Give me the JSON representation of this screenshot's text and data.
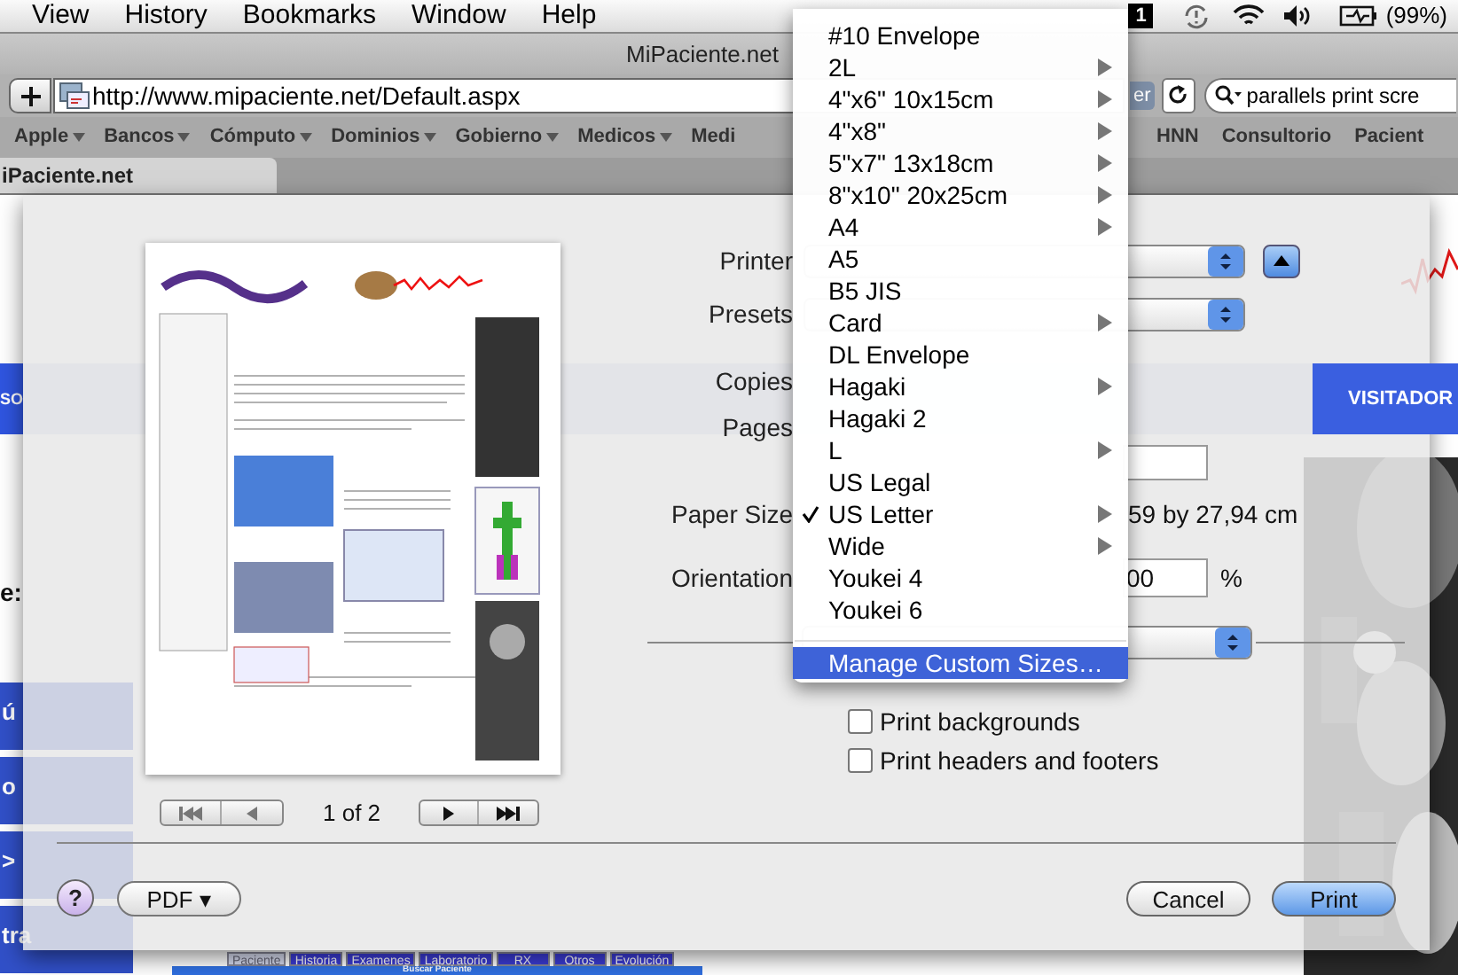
{
  "menu_bar": {
    "items": [
      "View",
      "History",
      "Bookmarks",
      "Window",
      "Help"
    ],
    "badge": "1",
    "battery": "(99%)"
  },
  "window": {
    "title": "MiPaciente.net"
  },
  "toolbar": {
    "address": "http://www.mipaciente.net/Default.aspx",
    "reader_button": "er",
    "search": "parallels print scre"
  },
  "bookmarks": [
    {
      "label": "Apple",
      "has_menu": true
    },
    {
      "label": "Bancos",
      "has_menu": true
    },
    {
      "label": "Cómputo",
      "has_menu": true
    },
    {
      "label": "Dominios",
      "has_menu": true
    },
    {
      "label": "Gobierno",
      "has_menu": true
    },
    {
      "label": "Medicos",
      "has_menu": true
    },
    {
      "label": "Medi",
      "has_menu": false
    }
  ],
  "bookmarks_right": [
    {
      "label": "HNN",
      "has_menu": false
    },
    {
      "label": "Consultorio",
      "has_menu": false
    },
    {
      "label": "Pacient",
      "has_menu": false
    }
  ],
  "tabs": [
    {
      "label": "iPaciente.net",
      "selected": true
    }
  ],
  "web_page": {
    "banner_label": "SO",
    "field_label": "e:",
    "side_menu": [
      "ú",
      "o",
      ">",
      "tra"
    ],
    "visitor_tab": "VISITADOR",
    "record_tabs": [
      {
        "label": "Paciente",
        "selected": true
      },
      {
        "label": "Historia",
        "selected": false
      },
      {
        "label": "Examenes",
        "selected": false
      },
      {
        "label": "Laboratorio",
        "selected": false
      },
      {
        "label": "RX",
        "selected": false
      },
      {
        "label": "Otros",
        "selected": false
      },
      {
        "label": "Evolución",
        "selected": false
      }
    ],
    "search_header": "Buscar Paciente"
  },
  "print_dialog": {
    "page_indicator": "1 of 2",
    "labels": {
      "printer": "Printer",
      "presets": "Presets",
      "copies": "Copies",
      "pages": "Pages",
      "paper_size": "Paper Size",
      "orientation": "Orientation"
    },
    "paper_dimensions": "59 by 27,94 cm",
    "scale_value": "00",
    "scale_unit": "%",
    "options": [
      {
        "label": "Print backgrounds",
        "checked": false
      },
      {
        "label": "Print headers and footers",
        "checked": false
      }
    ],
    "help_button": "?",
    "pdf_button": "PDF ▾",
    "buttons": [
      {
        "label": "Cancel",
        "default": false
      },
      {
        "label": "Print",
        "default": true
      }
    ]
  },
  "paper_menu": {
    "items": [
      {
        "label": "#10 Envelope",
        "submenu": false,
        "checked": false
      },
      {
        "label": "2L",
        "submenu": true,
        "checked": false
      },
      {
        "label": "4\"x6\" 10x15cm",
        "submenu": true,
        "checked": false
      },
      {
        "label": "4\"x8\"",
        "submenu": true,
        "checked": false
      },
      {
        "label": "5\"x7\" 13x18cm",
        "submenu": true,
        "checked": false
      },
      {
        "label": "8\"x10\" 20x25cm",
        "submenu": true,
        "checked": false
      },
      {
        "label": "A4",
        "submenu": true,
        "checked": false
      },
      {
        "label": "A5",
        "submenu": false,
        "checked": false
      },
      {
        "label": "B5 JIS",
        "submenu": false,
        "checked": false
      },
      {
        "label": "Card",
        "submenu": true,
        "checked": false
      },
      {
        "label": "DL Envelope",
        "submenu": false,
        "checked": false
      },
      {
        "label": "Hagaki",
        "submenu": true,
        "checked": false
      },
      {
        "label": "Hagaki 2",
        "submenu": false,
        "checked": false
      },
      {
        "label": "L",
        "submenu": true,
        "checked": false
      },
      {
        "label": "US Legal",
        "submenu": false,
        "checked": false
      },
      {
        "label": "US Letter",
        "submenu": true,
        "checked": true
      },
      {
        "label": "Wide",
        "submenu": true,
        "checked": false
      },
      {
        "label": "Youkei 4",
        "submenu": false,
        "checked": false
      },
      {
        "label": "Youkei 6",
        "submenu": false,
        "checked": false
      }
    ],
    "manage": {
      "label": "Manage Custom Sizes…",
      "highlighted": true
    }
  }
}
